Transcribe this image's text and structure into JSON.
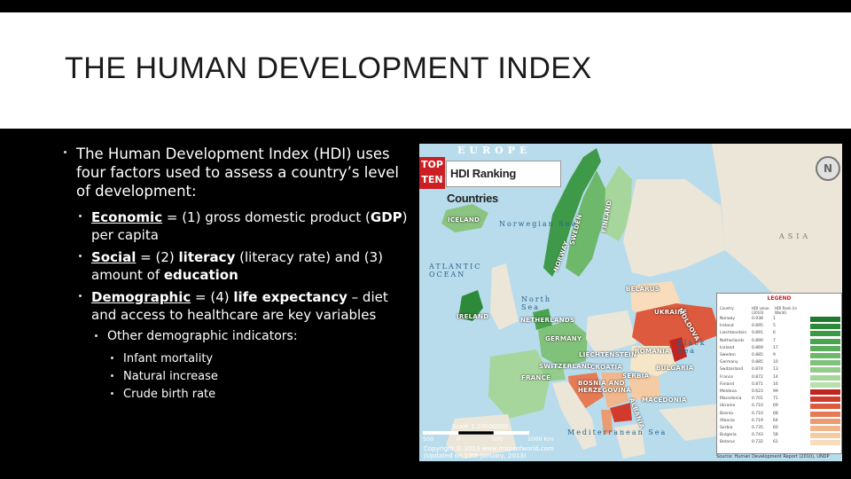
{
  "slide": {
    "title": "THE HUMAN DEVELOPMENT INDEX",
    "bullet_main": "The Human Development Index (HDI) uses four factors used to assess a country’s level of development:",
    "sub_bullets": [
      {
        "term": "Economic",
        "rest_a": " = (1) gross domestic product (",
        "bold_a": "GDP",
        "rest_b": ") per capita"
      },
      {
        "term": "Social",
        "rest_a": " = (2) ",
        "bold_a": "literacy",
        "rest_b": " (literacy rate) and (3) amount of ",
        "bold_b": "education"
      },
      {
        "term": "Demographic",
        "rest_a": " = (4) ",
        "bold_a": "life expectancy",
        "rest_b": " – diet and access to healthcare are key variables"
      }
    ],
    "other_indicators": "Other demographic indicators:",
    "indicators": [
      "Infant mortality",
      "Natural increase",
      "Crude birth rate"
    ]
  },
  "map": {
    "top_label": "TOP",
    "ten_label": "TEN",
    "ranking_title": "HDI Ranking Countries",
    "europe": "EUROPE",
    "asia": "ASIA",
    "compass": "N",
    "oceans": [
      "Norwegian Sea",
      "ATLANTIC OCEAN",
      "North Sea",
      "Black Sea",
      "Mediterranean Sea"
    ],
    "countries": [
      "ICELAND",
      "NORWAY",
      "SWEDEN",
      "FINLAND",
      "IRELAND",
      "NETHERLANDS",
      "GERMANY",
      "BELARUS",
      "UKRAINE",
      "MOLDOVA",
      "LIECHTENSTEIN",
      "ROMANIA",
      "SWITZERLAND",
      "CROATIA",
      "BULGARIA",
      "FRANCE",
      "SERBIA",
      "BOSNIA AND HERZEGOVINA",
      "MACEDONIA",
      "ALBANIA"
    ],
    "legend_title": "LEGEND",
    "legend_headers": [
      "Country",
      "HDI value (2010)",
      "HDI Rank (in World)"
    ],
    "legend_rows": [
      {
        "name": "Norway",
        "value": "0.938",
        "rank": "1",
        "color": "#1f7a2f"
      },
      {
        "name": "Ireland",
        "value": "0.895",
        "rank": "5",
        "color": "#2d8a38"
      },
      {
        "name": "Liechtenstein",
        "value": "0.891",
        "rank": "6",
        "color": "#3b9843"
      },
      {
        "name": "Netherlands",
        "value": "0.890",
        "rank": "7",
        "color": "#4aa34f"
      },
      {
        "name": "Iceland",
        "value": "0.869",
        "rank": "17",
        "color": "#5bad5c"
      },
      {
        "name": "Sweden",
        "value": "0.885",
        "rank": "9",
        "color": "#6db86a"
      },
      {
        "name": "Germany",
        "value": "0.885",
        "rank": "10",
        "color": "#80c27a"
      },
      {
        "name": "Switzerland",
        "value": "0.874",
        "rank": "13",
        "color": "#93cc8b"
      },
      {
        "name": "France",
        "value": "0.872",
        "rank": "14",
        "color": "#a6d69c"
      },
      {
        "name": "Finland",
        "value": "0.871",
        "rank": "16",
        "color": "#b9e0ad"
      },
      {
        "name": "Moldova",
        "value": "0.623",
        "rank": "99",
        "color": "#c0261f"
      },
      {
        "name": "Macedonia",
        "value": "0.701",
        "rank": "71",
        "color": "#d03b2d"
      },
      {
        "name": "Ukraine",
        "value": "0.710",
        "rank": "69",
        "color": "#dd5a3f"
      },
      {
        "name": "Bosnia",
        "value": "0.710",
        "rank": "68",
        "color": "#e57a55"
      },
      {
        "name": "Albania",
        "value": "0.719",
        "rank": "64",
        "color": "#ec9a70"
      },
      {
        "name": "Serbia",
        "value": "0.735",
        "rank": "60",
        "color": "#f1b68b"
      },
      {
        "name": "Bulgaria",
        "value": "0.743",
        "rank": "58",
        "color": "#f5cba3"
      },
      {
        "name": "Belarus",
        "value": "0.732",
        "rank": "61",
        "color": "#f8dcbb"
      }
    ],
    "scale_label": "Scale 1:20000000",
    "scale_ticks": [
      "500",
      "0",
      "500",
      "1000 Km"
    ],
    "copyright_line1": "Copyright © 2013 www.mapsofworld.com",
    "copyright_line2": "(Updated on 13th January, 2013)",
    "source": "Source: Human Development Report (2010), UNDP",
    "watermark": "www.mapsofworld.com"
  }
}
